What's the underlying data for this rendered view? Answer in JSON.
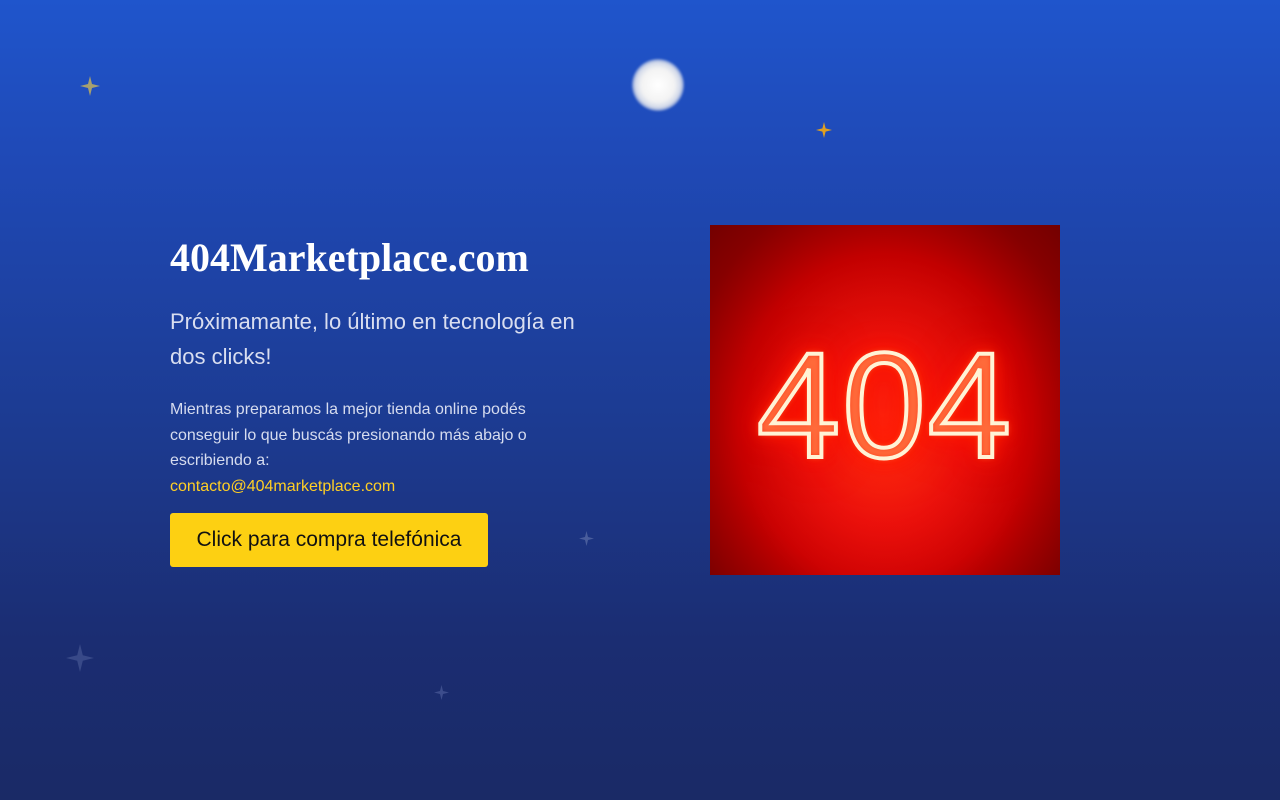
{
  "site": {
    "title": "404Marketplace.com",
    "subtitle": "Próximamante, lo último en tecnología en dos clicks!",
    "description": "Mientras preparamos la mejor tienda online podés conseguir lo que buscás presionando más abajo o escribiendo a:",
    "email": "contacto@404marketplace.com"
  },
  "cta": {
    "label": "Click para compra telefónica"
  },
  "hero_image": {
    "sign_text": "404",
    "icon": "neon-404-sign"
  },
  "decor": {
    "moon_icon": "moon-icon",
    "star_icon": "sparkle-star-icon"
  },
  "colors": {
    "background_top": "#1f55cc",
    "background_bottom": "#1a2a66",
    "accent_yellow": "#fdd012",
    "email_color": "#ffcf24",
    "neon_red": "#ff1a00"
  }
}
